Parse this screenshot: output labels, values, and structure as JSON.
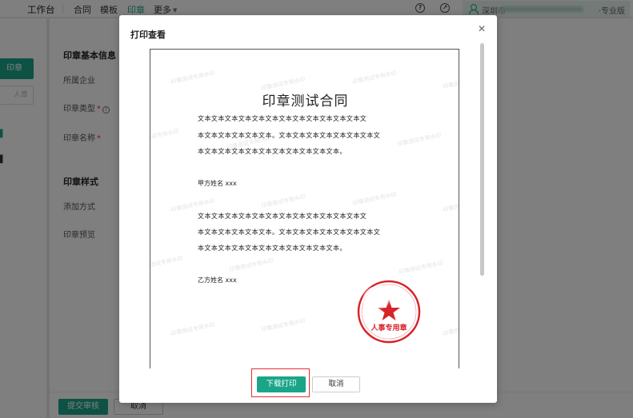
{
  "topbar": {
    "nav": [
      "工作台",
      "合同",
      "模板",
      "印章",
      "更多"
    ],
    "active_nav": "印章",
    "user_org": "深圳市",
    "edition": "专业版"
  },
  "sidebar": {
    "create_button": "印章",
    "search_placeholder": "人章"
  },
  "form": {
    "basic_section": "印章基本信息",
    "org_label": "所属企业",
    "type_label": "印章类型",
    "name_label": "印章名称",
    "style_section": "印章样式",
    "add_method_label": "添加方式",
    "preview_label": "印章预览",
    "submit_button": "提交审核",
    "cancel_button": "取消"
  },
  "modal": {
    "title": "打印查看",
    "document": {
      "title": "印章测试合同",
      "para1": [
        "文本文本文本文本文本文本文本文本文本文本文本文本文",
        "本文本文本文本文本文本。文本文本文本文本文本文本文本文",
        "本文本文本文本文本文本文本文本文本文本文本。"
      ],
      "party_a": "甲方姓名 xxx",
      "para2": [
        "文本文本文本文本文本文本文本文本文本文本文本文本文",
        "本文本文本文本文本文本。文本文本文本文本文本文本文本文",
        "本文本文本文本文本文本文本文本文本文本文本。"
      ],
      "party_b": "乙方姓名 xxx",
      "watermark": "印章测试专用水印",
      "seal_text": "人事专用章"
    },
    "download_button": "下载打印",
    "cancel_button": "取消"
  },
  "colors": {
    "accent": "#1aa589",
    "seal_red": "#d8232a",
    "highlight": "#e23030"
  }
}
